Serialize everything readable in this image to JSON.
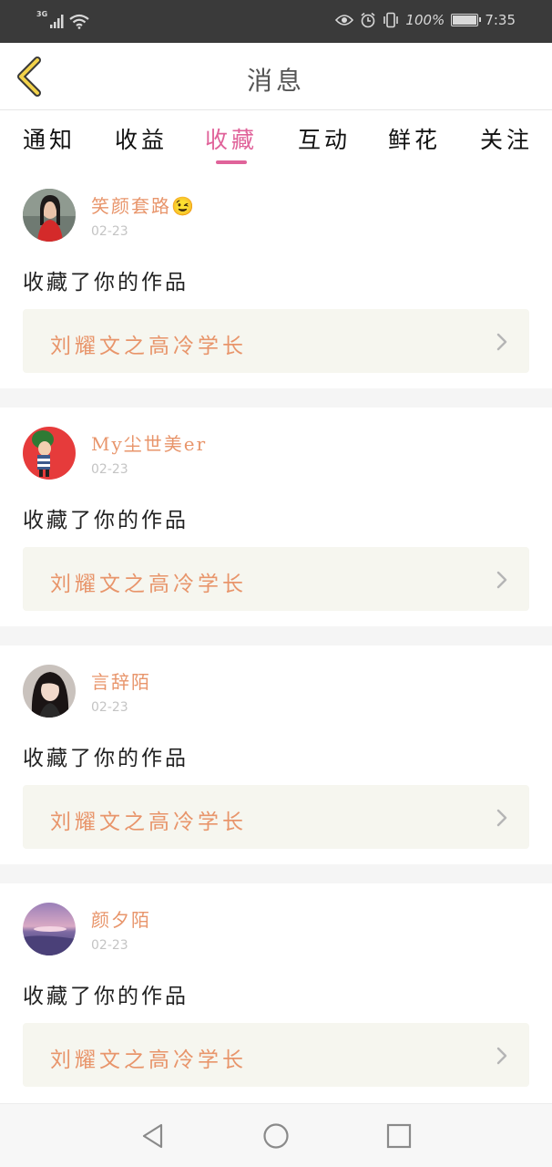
{
  "status_bar": {
    "network": "3G",
    "battery": "100%",
    "battery_level": 1.0,
    "time": "7:35",
    "icons": [
      "signal-icon",
      "wifi-icon",
      "eye-icon",
      "alarm-icon",
      "vibrate-icon",
      "battery-icon"
    ]
  },
  "header": {
    "back_icon": "chevron-left-icon",
    "title": "消息"
  },
  "tabs": [
    {
      "label": "通知",
      "active": false
    },
    {
      "label": "收益",
      "active": false
    },
    {
      "label": "收藏",
      "active": true
    },
    {
      "label": "互动",
      "active": false
    },
    {
      "label": "鲜花",
      "active": false
    },
    {
      "label": "关注",
      "active": false
    }
  ],
  "colors": {
    "accent": "#e0639a",
    "username": "#e8956b",
    "card_bg": "#f6f6ef",
    "status_bar": "#3a3a3a"
  },
  "items": [
    {
      "username": "笑颜套路😉",
      "date": "02-23",
      "action": "收藏了你的作品",
      "work_title": "刘耀文之高冷学长",
      "avatar": "avatar-woman-red"
    },
    {
      "username": "My尘世美er",
      "date": "02-23",
      "action": "收藏了你的作品",
      "work_title": "刘耀文之高冷学长",
      "avatar": "avatar-cartoon-red"
    },
    {
      "username": "言辞陌",
      "date": "02-23",
      "action": "收藏了你的作品",
      "work_title": "刘耀文之高冷学长",
      "avatar": "avatar-girl-dark"
    },
    {
      "username": "颜夕陌",
      "date": "02-23",
      "action": "收藏了你的作品",
      "work_title": "刘耀文之高冷学长",
      "avatar": "avatar-sunset-sky"
    }
  ],
  "bottom_nav": [
    "back-triangle-icon",
    "home-circle-icon",
    "recents-square-icon"
  ]
}
